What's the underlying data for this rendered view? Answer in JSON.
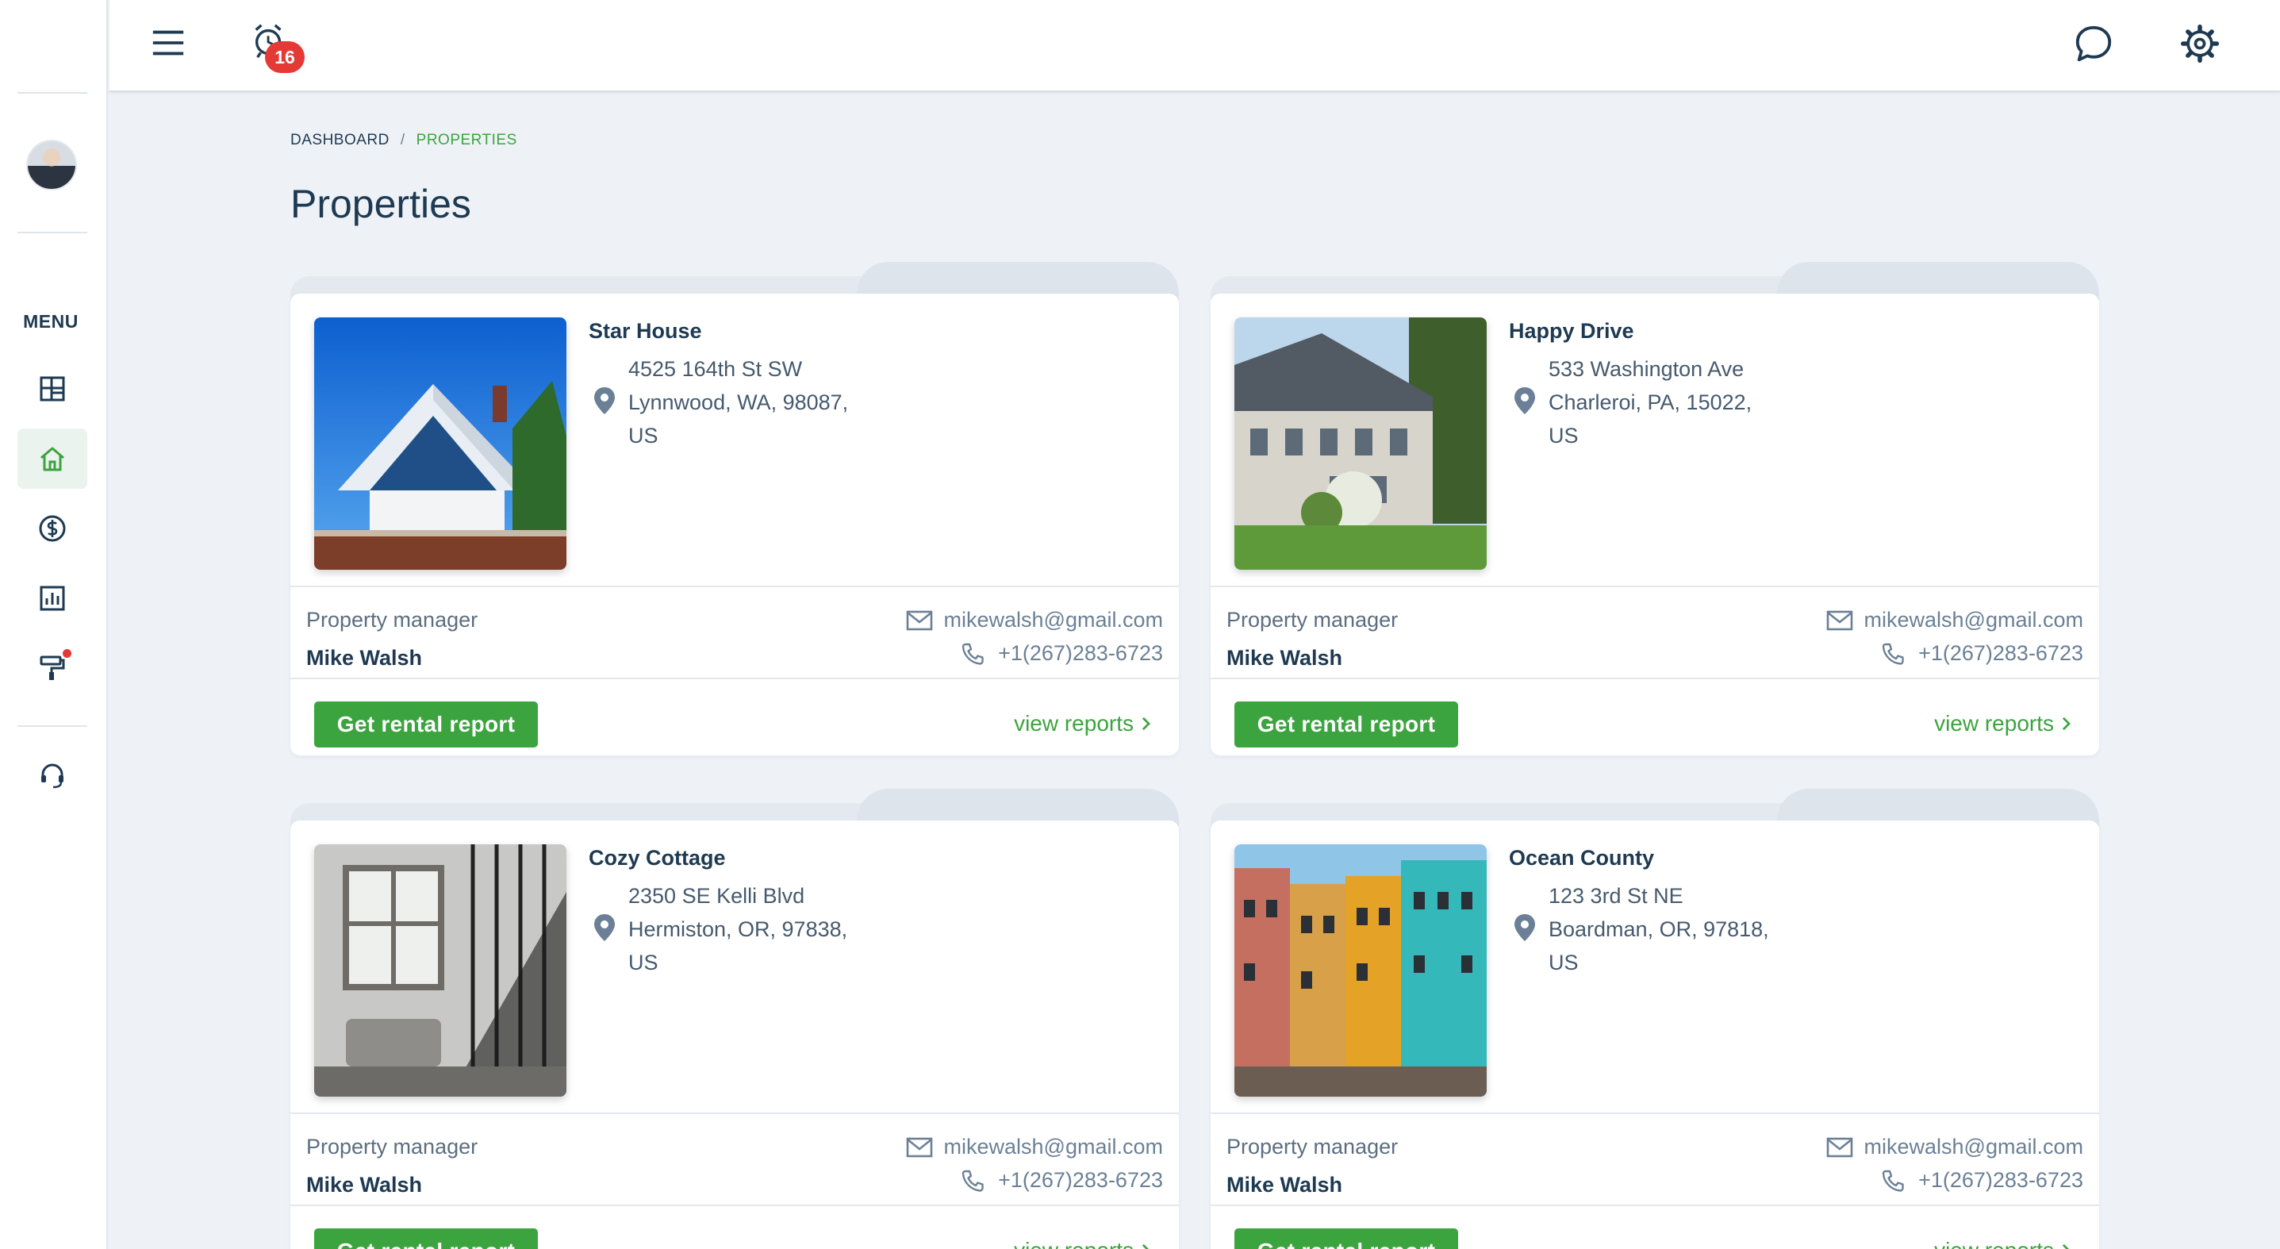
{
  "colors": {
    "accent": "#3ba43e",
    "text": "#1e3a52",
    "badge": "#e53935",
    "background": "#eef2f7"
  },
  "sidebar": {
    "menu_label": "MENU",
    "items": [
      {
        "icon": "dashboard-grid-icon",
        "active": false
      },
      {
        "icon": "home-icon",
        "active": true
      },
      {
        "icon": "dollar-circle-icon",
        "active": false
      },
      {
        "icon": "bar-chart-icon",
        "active": false
      },
      {
        "icon": "paint-roller-icon",
        "active": false,
        "has_notification": true
      },
      {
        "icon": "headset-icon",
        "active": false
      }
    ]
  },
  "topbar": {
    "menu_icon": "hamburger-icon",
    "alarm_icon": "alarm-clock-icon",
    "alarm_count": "16",
    "chat_icon": "chat-bubble-icon",
    "settings_icon": "gear-icon"
  },
  "breadcrumb": {
    "items": [
      "DASHBOARD",
      "PROPERTIES"
    ],
    "separator": "/"
  },
  "page": {
    "title": "Properties"
  },
  "properties": [
    {
      "name": "Star House",
      "address_line1": "4525 164th St SW",
      "address_line2": "Lynnwood, WA, 98087,",
      "country": "US",
      "manager_label": "Property manager",
      "manager_name": "Mike Walsh",
      "email": "mikewalsh@gmail.com",
      "phone": "+1(267)283-6723",
      "rent_button": "Get rental report",
      "view_reports": "view reports"
    },
    {
      "name": "Happy Drive",
      "address_line1": "533 Washington Ave",
      "address_line2": "Charleroi, PA, 15022,",
      "country": "US",
      "manager_label": "Property manager",
      "manager_name": "Mike Walsh",
      "email": "mikewalsh@gmail.com",
      "phone": "+1(267)283-6723",
      "rent_button": "Get rental report",
      "view_reports": "view reports"
    },
    {
      "name": "Cozy Cottage",
      "address_line1": "2350 SE Kelli Blvd",
      "address_line2": "Hermiston, OR, 97838,",
      "country": "US",
      "manager_label": "Property manager",
      "manager_name": "Mike Walsh",
      "email": "mikewalsh@gmail.com",
      "phone": "+1(267)283-6723",
      "rent_button": "Get rental report",
      "view_reports": "view reports"
    },
    {
      "name": "Ocean County",
      "address_line1": "123 3rd St NE",
      "address_line2": "Boardman, OR, 97818,",
      "country": "US",
      "manager_label": "Property manager",
      "manager_name": "Mike Walsh",
      "email": "mikewalsh@gmail.com",
      "phone": "+1(267)283-6723",
      "rent_button": "Get rental report",
      "view_reports": "view reports"
    }
  ]
}
